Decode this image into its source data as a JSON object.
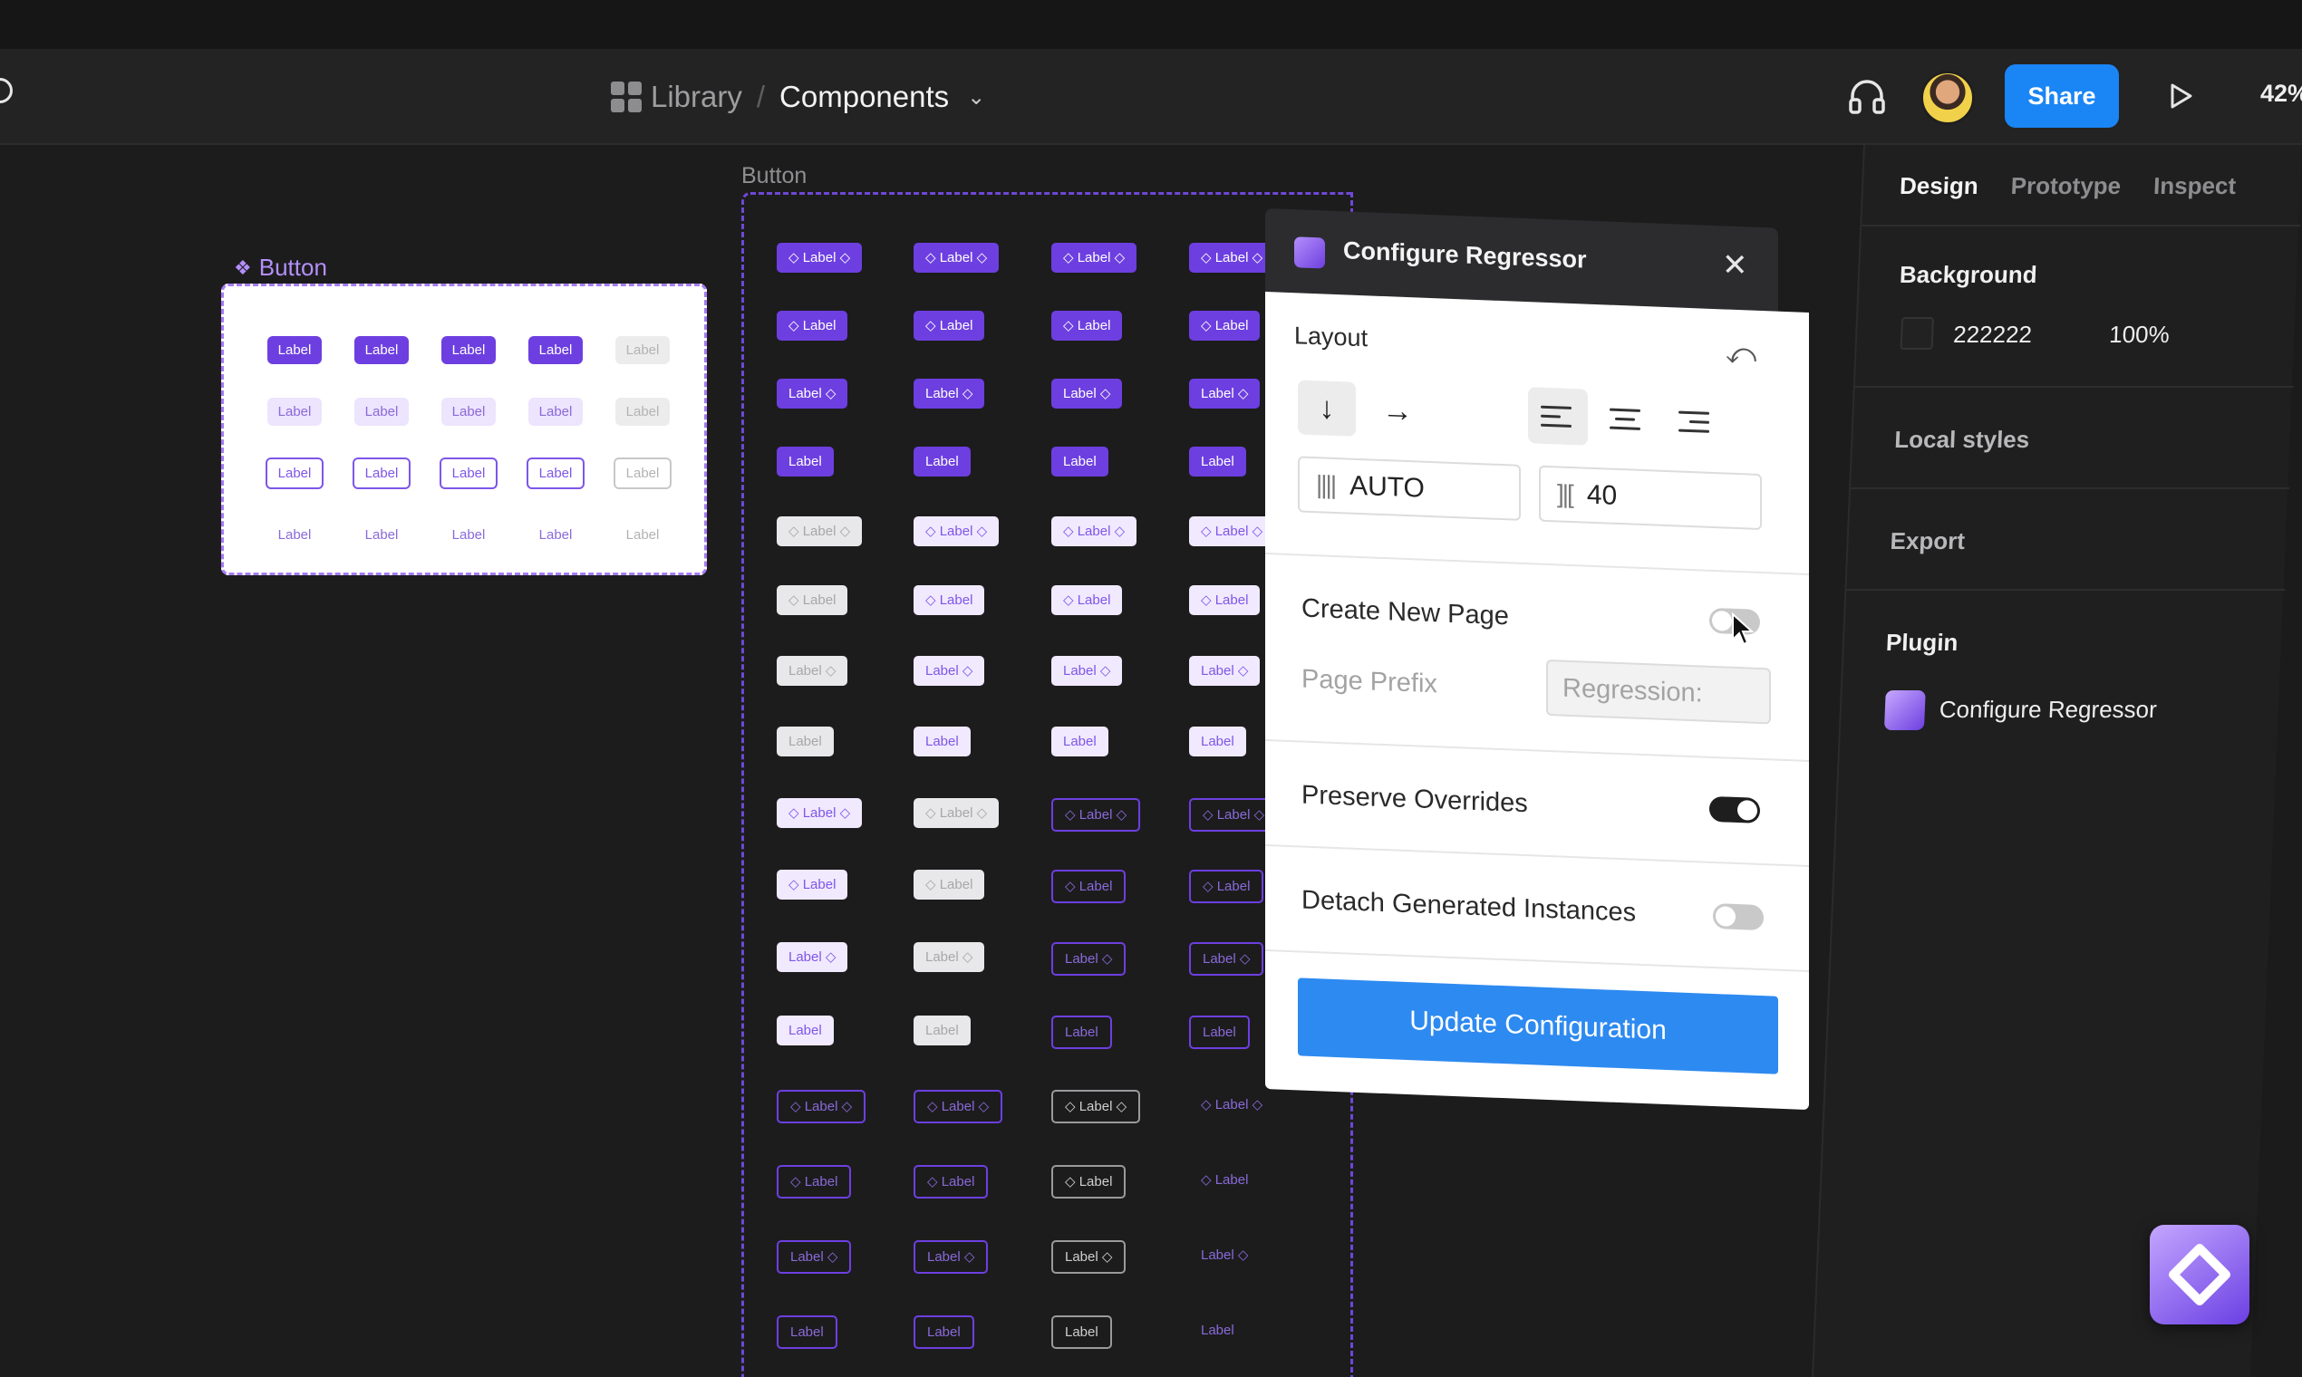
{
  "toolbar": {
    "breadcrumb_library": "Library",
    "breadcrumb_separator": "/",
    "breadcrumb_current": "Components",
    "share_label": "Share",
    "zoom": "42%"
  },
  "canvas": {
    "frame1_label": "Button",
    "frame2_label": "Button",
    "pill_label": "Label"
  },
  "dialog": {
    "title": "Configure Regressor",
    "layout_title": "Layout",
    "spacing_mode": "AUTO",
    "gap_value": "40",
    "create_new_page_label": "Create New Page",
    "create_new_page_on": false,
    "page_prefix_label": "Page Prefix",
    "page_prefix_placeholder": "Regression:",
    "preserve_overrides_label": "Preserve Overrides",
    "preserve_overrides_on": true,
    "detach_label": "Detach Generated Instances",
    "detach_on": false,
    "update_button": "Update Configuration"
  },
  "right_panel": {
    "tabs": [
      "Design",
      "Prototype",
      "Inspect"
    ],
    "active_tab": "Design",
    "background_title": "Background",
    "background_hex": "222222",
    "background_opacity": "100%",
    "local_styles": "Local styles",
    "export": "Export",
    "plugin_title": "Plugin",
    "plugin_name": "Configure Regressor"
  },
  "colors": {
    "accent": "#1a85f5",
    "brand_purple": "#6d3fe0"
  }
}
